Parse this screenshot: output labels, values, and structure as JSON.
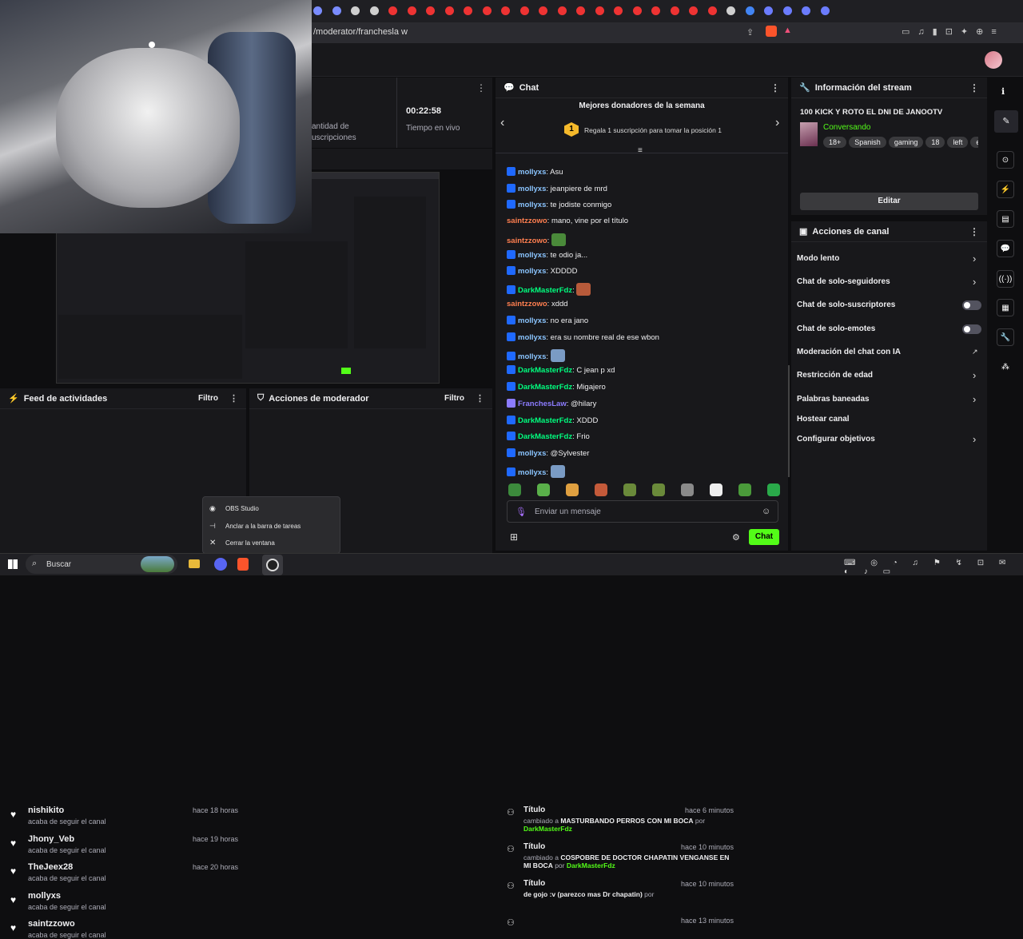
{
  "browser": {
    "address": "/moderator/franchesla w"
  },
  "stats": {
    "sub_label_1": "antidad de",
    "sub_label_2": "uscripciones",
    "uptime": "00:22:58",
    "uptime_label": "Tiempo en vivo"
  },
  "chat": {
    "title": "Chat",
    "donors_title": "Mejores donadores de la semana",
    "donors_rank": "1",
    "donors_text": "Regala 1 suscripción para tomar la posición 1",
    "input_placeholder": "Enviar un mensaje",
    "send_label": "Chat",
    "messages": [
      {
        "user": "mollyxs",
        "text": ": Asu",
        "color": "#8bc5ff"
      },
      {
        "user": "mollyxs",
        "text": ": jeanpiere de mrd",
        "color": "#8bc5ff"
      },
      {
        "user": "mollyxs",
        "text": ": te jodiste conmigo",
        "color": "#8bc5ff"
      },
      {
        "user": "saintzzowo",
        "text": ": mano, vine por el título",
        "color": "#ff7f50"
      },
      {
        "user": "saintzzowo",
        "text": ":",
        "color": "#ff7f50"
      },
      {
        "user": "mollyxs",
        "text": ": te odio ja...",
        "color": "#8bc5ff"
      },
      {
        "user": "mollyxs",
        "text": ": XDDDD",
        "color": "#8bc5ff"
      },
      {
        "user": "DarkMasterFdz",
        "text": ":",
        "color": "#00ff7f"
      },
      {
        "user": "saintzzowo",
        "text": ": xddd",
        "color": "#ff7f50"
      },
      {
        "user": "mollyxs",
        "text": ": no era jano",
        "color": "#8bc5ff"
      },
      {
        "user": "mollyxs",
        "text": ": era su nombre real de ese wbon",
        "color": "#8bc5ff"
      },
      {
        "user": "mollyxs",
        "text": ":",
        "color": "#8bc5ff"
      },
      {
        "user": "DarkMasterFdz",
        "text": ": C jean p xd",
        "color": "#00ff7f"
      },
      {
        "user": "DarkMasterFdz",
        "text": ": Migajero",
        "color": "#00ff7f"
      },
      {
        "user": "FranchesLaw",
        "text": ": @hilary",
        "color": "#8c7cff"
      },
      {
        "user": "DarkMasterFdz",
        "text": ": XDDD",
        "color": "#00ff7f"
      },
      {
        "user": "DarkMasterFdz",
        "text": ": Frio",
        "color": "#00ff7f"
      },
      {
        "user": "mollyxs",
        "text": ": @Sylvester",
        "color": "#8bc5ff"
      },
      {
        "user": "mollyxs",
        "text": ":",
        "color": "#8bc5ff"
      }
    ]
  },
  "stream_info": {
    "header": "Información del stream",
    "title": "100 KICK Y ROTO EL DNI DE JANOOTV",
    "category": "Conversando",
    "tags": [
      "18+",
      "Spanish",
      "gaming",
      "18",
      "left",
      "espa"
    ],
    "edit_label": "Editar"
  },
  "channel_actions": {
    "header": "Acciones de canal",
    "items": [
      "Modo lento",
      "Chat de solo-seguidores",
      "Chat de solo-suscriptores",
      "Chat de solo-emotes",
      "Moderación del chat con IA",
      "Restricción de edad",
      "Palabras baneadas",
      "Hostear canal",
      "Configurar objetivos"
    ]
  },
  "activity_feed": {
    "header": "Feed de actividades",
    "filter": "Filtro",
    "items": [
      {
        "user": "nishikito",
        "desc": "acaba de seguir el canal",
        "time": "hace 18 horas"
      },
      {
        "user": "Jhony_Veb",
        "desc": "acaba de seguir el canal",
        "time": "hace 19 horas"
      },
      {
        "user": "TheJeex28",
        "desc": "acaba de seguir el canal",
        "time": "hace 20 horas"
      },
      {
        "user": "mollyxs",
        "desc": "acaba de seguir el canal",
        "time": ""
      },
      {
        "user": "saintzzowo",
        "desc": "acaba de seguir el canal",
        "time": ""
      }
    ]
  },
  "mod_actions": {
    "header": "Acciones de moderador",
    "filter": "Filtro",
    "items": [
      {
        "title": "Título",
        "time": "hace 6 minutos",
        "pre": "cambiado a ",
        "bold": "MASTURBANDO PERROS CON MI BOCA",
        "mid": " por ",
        "by": "DarkMasterFdz"
      },
      {
        "title": "Título",
        "time": "hace 10 minutos",
        "pre": "cambiado a ",
        "bold": "COSPOBRE DE DOCTOR CHAPATIN VENGANSE EN MI BOCA",
        "mid": " por ",
        "by": "DarkMasterFdz"
      },
      {
        "title": "Título",
        "time": "hace 10 minutos",
        "pre": "",
        "bold": "de gojo :v (parezco mas Dr chapatin)",
        "mid": " por",
        "by": ""
      },
      {
        "title": "",
        "time": "hace 13 minutos",
        "pre": "",
        "bold": "",
        "mid": "",
        "by": ""
      }
    ]
  },
  "context_menu": {
    "items": [
      "OBS Studio",
      "Anclar a la barra de tareas",
      "Cerrar la ventana"
    ]
  },
  "taskbar": {
    "search": "Buscar"
  }
}
